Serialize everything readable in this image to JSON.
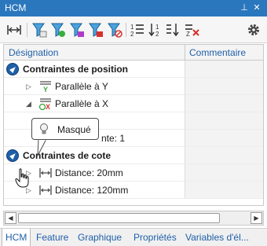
{
  "window": {
    "title": "HCM",
    "pin_glyph": "⊥",
    "close_glyph": "✕"
  },
  "table": {
    "columns": [
      "Désignation",
      "Commentaire"
    ],
    "groups": [
      {
        "label": "Contraintes de position",
        "rows": [
          {
            "label": "Parallèle à Y",
            "icon": "parallel-y-icon",
            "expanded": false
          },
          {
            "label": "Parallèle à X",
            "icon": "parallel-x-icon",
            "expanded": true
          },
          {
            "label": "",
            "icon": ""
          },
          {
            "label": "nte: 1",
            "icon": ""
          }
        ]
      },
      {
        "label": "Contraintes de cote",
        "rows": [
          {
            "label": "Distance: 20mm",
            "icon": "distance-icon",
            "expanded": false
          },
          {
            "label": "Distance: 120mm",
            "icon": "distance-icon",
            "expanded": false
          }
        ]
      }
    ]
  },
  "tooltip": {
    "text": "Masqué",
    "icon": "lightbulb-icon"
  },
  "tabs": [
    {
      "label": "HCM",
      "active": true
    },
    {
      "label": "Feature",
      "active": false
    },
    {
      "label": "Graphique",
      "active": false
    },
    {
      "label": "Propriétés",
      "active": false
    },
    {
      "label": "Variables d'él...",
      "active": false
    }
  ],
  "colors": {
    "titlebar": "#2b77bd",
    "accent": "#1f5fa8"
  }
}
